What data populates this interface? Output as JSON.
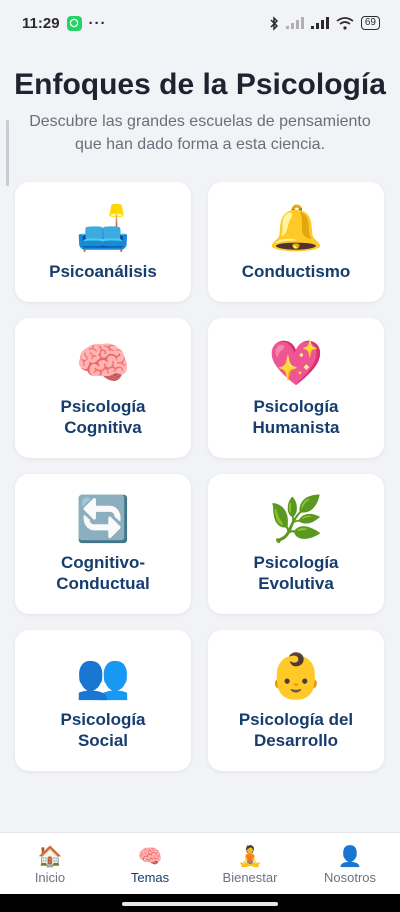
{
  "status": {
    "time": "11:29",
    "dots": "···",
    "battery": "69"
  },
  "header": {
    "title": "Enfoques de la Psicología",
    "subtitle": "Descubre las grandes escuelas de pensamiento que han dado forma a esta ciencia."
  },
  "cards": [
    {
      "emoji": "🛋️",
      "label": "Psicoanálisis"
    },
    {
      "emoji": "🔔",
      "label": "Conductismo"
    },
    {
      "emoji": "🧠",
      "label": "Psicología\nCognitiva"
    },
    {
      "emoji": "💖",
      "label": "Psicología\nHumanista"
    },
    {
      "emoji": "🔄",
      "label": "Cognitivo-\nConductual"
    },
    {
      "emoji": "🌿",
      "label": "Psicología\nEvolutiva"
    },
    {
      "emoji": "👥",
      "label": "Psicología\nSocial"
    },
    {
      "emoji": "👶",
      "label": "Psicología del\nDesarrollo"
    }
  ],
  "nav": [
    {
      "icon": "🏠",
      "label": "Inicio"
    },
    {
      "icon": "🧠",
      "label": "Temas"
    },
    {
      "icon": "🧘",
      "label": "Bienestar"
    },
    {
      "icon": "👤",
      "label": "Nosotros"
    }
  ],
  "active_nav": "Temas",
  "colors": {
    "card_label": "#173d6e",
    "background": "#f2f3f6"
  }
}
